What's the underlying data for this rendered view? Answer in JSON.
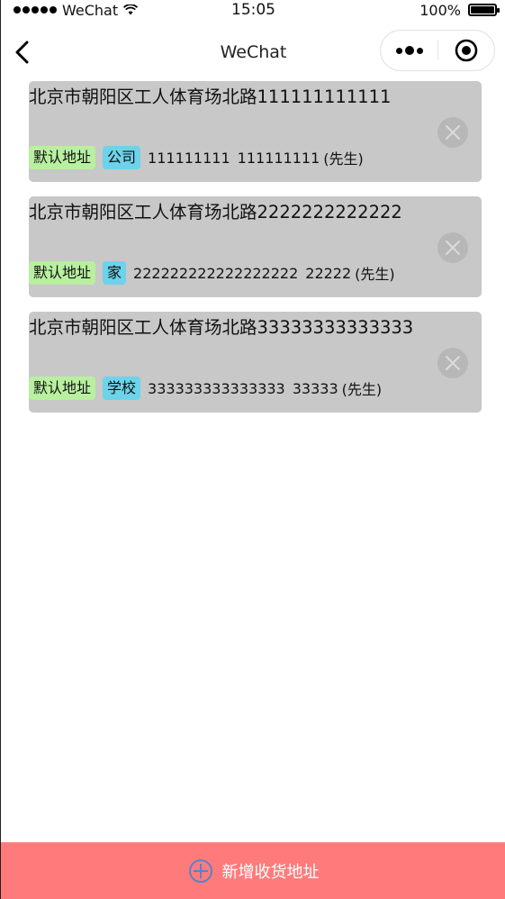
{
  "status_bar": {
    "carrier": "WeChat",
    "time": "15:05",
    "battery_percent_text": "100%",
    "battery_level": 1.0
  },
  "nav": {
    "title": "WeChat"
  },
  "addresses": [
    {
      "address": "北京市朝阳区工人体育场北路111111111111",
      "default_tag": "默认地址",
      "type_tag": "公司",
      "phone": "111111111",
      "name": "111111111",
      "title": "(先生)"
    },
    {
      "address": "北京市朝阳区工人体育场北路2222222222222",
      "default_tag": "默认地址",
      "type_tag": "家",
      "phone": "222222222222222222",
      "name": "22222",
      "title": "(先生)"
    },
    {
      "address": "北京市朝阳区工人体育场北路33333333333333",
      "default_tag": "默认地址",
      "type_tag": "学校",
      "phone": "333333333333333",
      "name": "33333",
      "title": "(先生)"
    }
  ],
  "add_button": {
    "label": "新增收货地址",
    "icon": "plus-circle-icon"
  },
  "colors": {
    "card_bg": "#c8c8c8",
    "default_tag_bg": "#b8f0a0",
    "type_tag_bg": "#6dd3ea",
    "add_button_bg": "#ff7b7b",
    "add_icon": "#5b82c8",
    "delete_button_bg": "#b7b7b7"
  }
}
